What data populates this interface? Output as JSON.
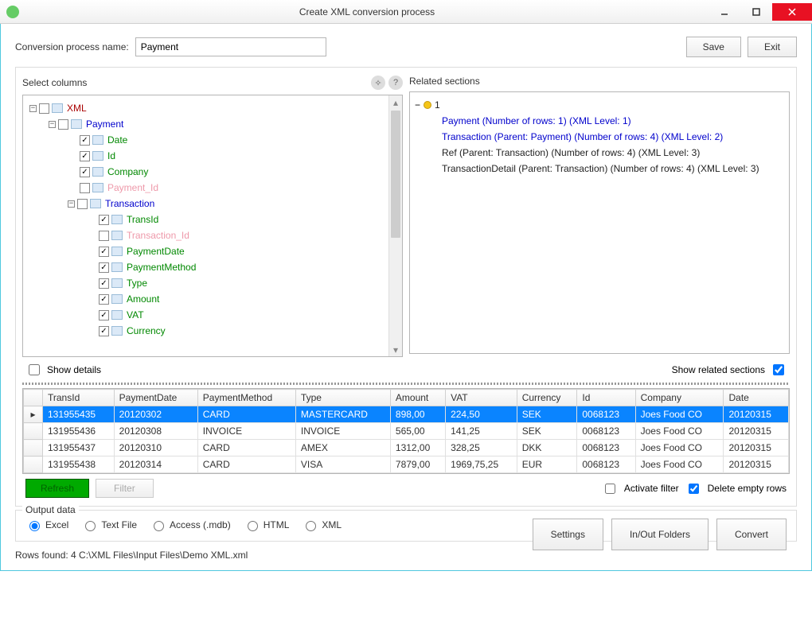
{
  "window": {
    "title": "Create XML conversion process"
  },
  "toprow": {
    "label": "Conversion process name:",
    "value": "Payment",
    "save": "Save",
    "exit": "Exit"
  },
  "panels": {
    "select_columns": "Select columns",
    "related_sections": "Related sections"
  },
  "tree": {
    "root": "XML",
    "payment": "Payment",
    "date": "Date",
    "id": "Id",
    "company": "Company",
    "payment_id": "Payment_Id",
    "transaction": "Transaction",
    "transid": "TransId",
    "transaction_id": "Transaction_Id",
    "paymentdate": "PaymentDate",
    "paymentmethod": "PaymentMethod",
    "type": "Type",
    "amount": "Amount",
    "vat": "VAT",
    "currency": "Currency"
  },
  "related": {
    "root": "1",
    "items": [
      "Payment (Number of rows: 1) (XML Level: 1)",
      "Transaction (Parent: Payment) (Number of rows: 4) (XML Level: 2)",
      "Ref (Parent: Transaction) (Number of rows: 4) (XML Level: 3)",
      "TransactionDetail (Parent: Transaction) (Number of rows: 4) (XML Level: 3)"
    ]
  },
  "checks": {
    "show_details": "Show details",
    "show_related": "Show related sections"
  },
  "grid": {
    "headers": [
      "TransId",
      "PaymentDate",
      "PaymentMethod",
      "Type",
      "Amount",
      "VAT",
      "Currency",
      "Id",
      "Company",
      "Date"
    ],
    "rows": [
      [
        "131955435",
        "20120302",
        "CARD",
        "MASTERCARD",
        "898,00",
        "224,50",
        "SEK",
        "0068123",
        "Joes Food CO",
        "20120315"
      ],
      [
        "131955436",
        "20120308",
        "INVOICE",
        "INVOICE",
        "565,00",
        "141,25",
        "SEK",
        "0068123",
        "Joes Food CO",
        "20120315"
      ],
      [
        "131955437",
        "20120310",
        "CARD",
        "AMEX",
        "1312,00",
        "328,25",
        "DKK",
        "0068123",
        "Joes Food CO",
        "20120315"
      ],
      [
        "131955438",
        "20120314",
        "CARD",
        "VISA",
        "7879,00",
        "1969,75,25",
        "EUR",
        "0068123",
        "Joes Food CO",
        "20120315"
      ]
    ],
    "refresh": "Refresh",
    "filter": "Filter",
    "activate_filter": "Activate filter",
    "delete_empty": "Delete empty rows"
  },
  "output": {
    "legend": "Output data",
    "excel": "Excel",
    "text": "Text File",
    "access": "Access (.mdb)",
    "html": "HTML",
    "xml": "XML",
    "settings": "Settings",
    "folders": "In/Out Folders",
    "convert": "Convert"
  },
  "status": "Rows found: 4   C:\\XML Files\\Input Files\\Demo XML.xml"
}
